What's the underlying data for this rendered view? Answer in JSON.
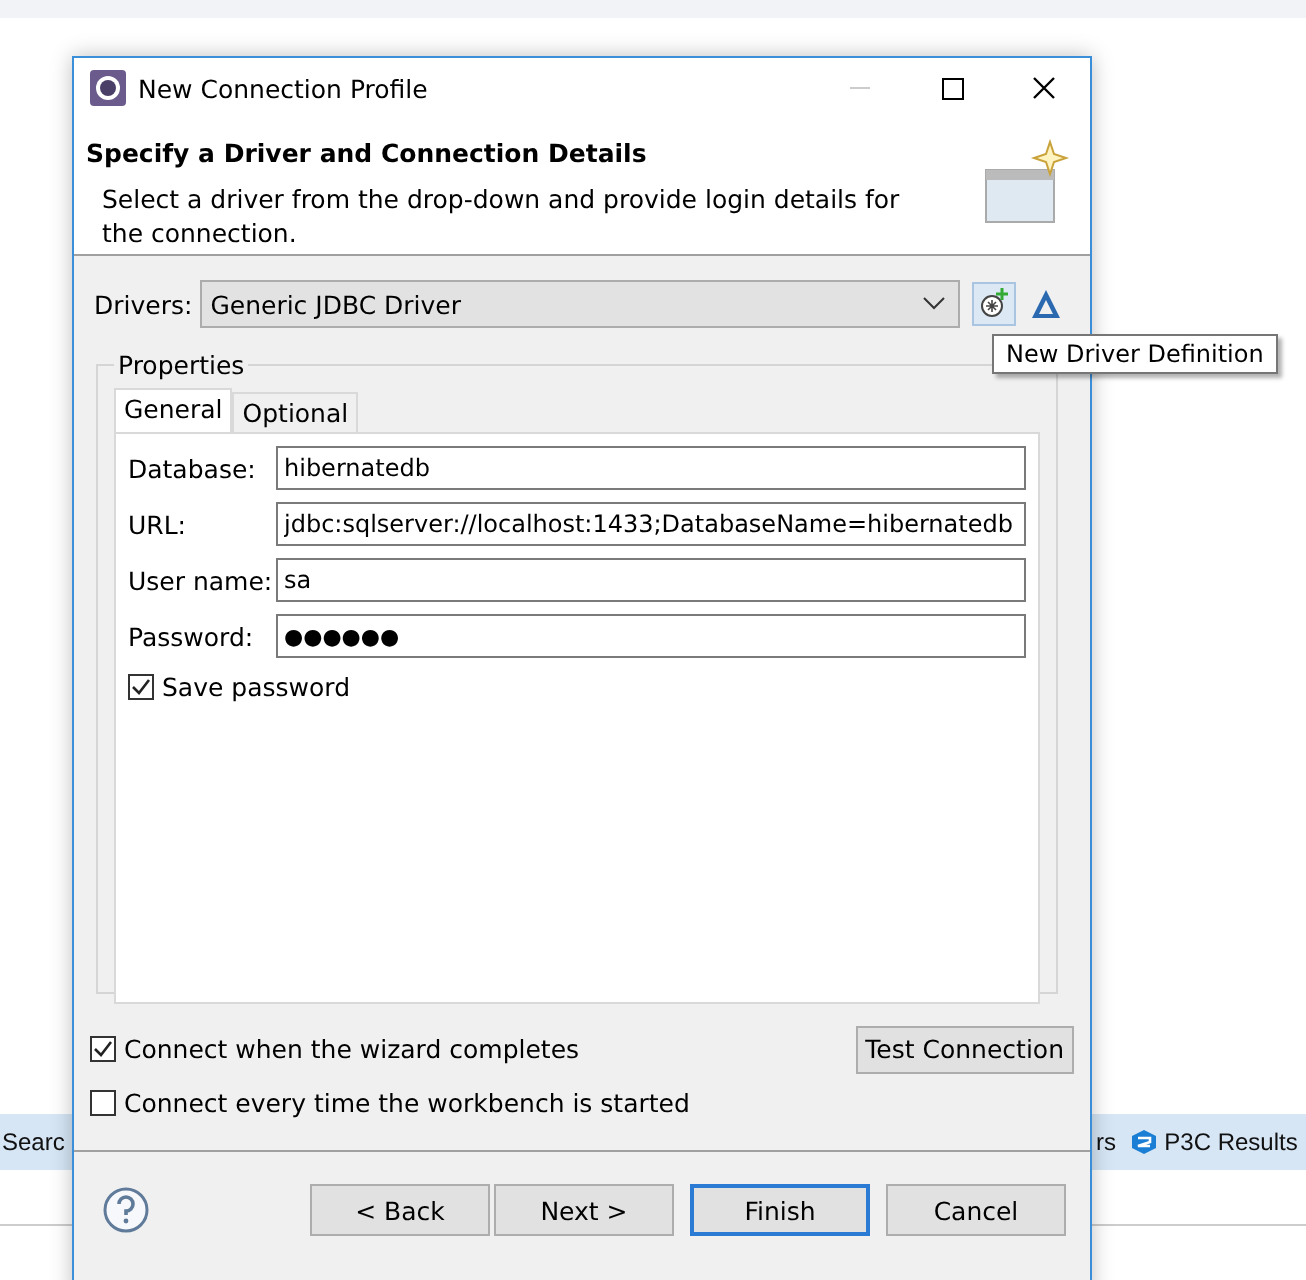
{
  "background": {
    "tabs": [
      {
        "label": "Searc",
        "kind": "text"
      },
      {
        "label": "rs",
        "kind": "text"
      },
      {
        "label": "P3C Results",
        "kind": "p3c"
      }
    ]
  },
  "window": {
    "title": "New Connection Profile",
    "minimize_disabled": true
  },
  "header": {
    "title": "Specify a Driver and Connection Details",
    "description": "Select a driver from the drop-down and provide login details for the connection."
  },
  "drivers": {
    "label": "Drivers:",
    "value": "Generic JDBC Driver"
  },
  "tooltip": "New Driver Definition",
  "properties": {
    "title": "Properties",
    "tabs": [
      {
        "label": "General",
        "selected": true
      },
      {
        "label": "Optional",
        "selected": false
      }
    ],
    "fields": [
      {
        "label": "Database:",
        "value": "hibernatedb",
        "kind": "text"
      },
      {
        "label": "URL:",
        "value": "jdbc:sqlserver://localhost:1433;DatabaseName=hibernatedb",
        "kind": "text"
      },
      {
        "label": "User name:",
        "value": "sa",
        "kind": "text"
      },
      {
        "label": "Password:",
        "value": "●●●●●●",
        "kind": "password"
      }
    ],
    "save_password": {
      "label": "Save password",
      "checked": true
    }
  },
  "options": [
    {
      "label": "Connect when the wizard completes",
      "checked": true
    },
    {
      "label": "Connect every time the workbench is started",
      "checked": false
    }
  ],
  "test_button": "Test Connection",
  "buttons": [
    {
      "label": "< Back",
      "default": false
    },
    {
      "label": "Next >",
      "default": false
    },
    {
      "label": "Finish",
      "default": true
    },
    {
      "label": "Cancel",
      "default": false
    }
  ]
}
